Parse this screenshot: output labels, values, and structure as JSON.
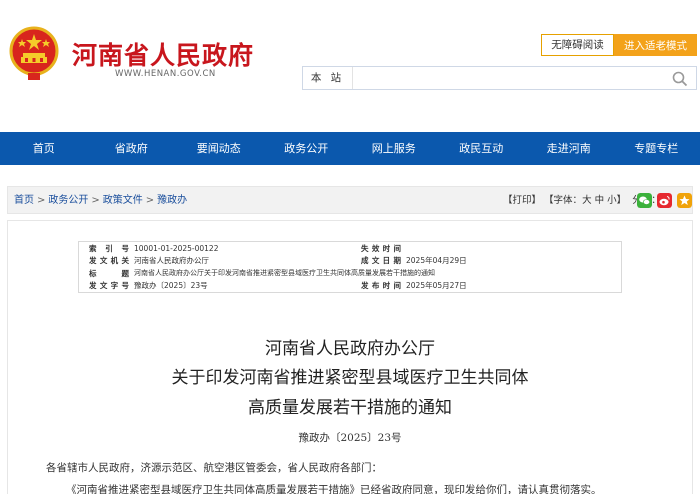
{
  "header": {
    "site_title": "河南省人民政府",
    "site_url": "WWW.HENAN.GOV.CN",
    "accessibility_label": "无障碍阅读",
    "elder_mode_label": "进入适老模式",
    "search_scope": "本 站",
    "search_placeholder": ""
  },
  "nav": {
    "items": [
      "首页",
      "省政府",
      "要闻动态",
      "政务公开",
      "网上服务",
      "政民互动",
      "走进河南",
      "专题专栏"
    ]
  },
  "breadcrumb": {
    "items": [
      "首页",
      "政务公开",
      "政策文件",
      "豫政办"
    ],
    "separator": ">"
  },
  "tools": {
    "print": "【打印】",
    "font_prefix": "【字体：",
    "font_large": "大",
    "font_medium": "中",
    "font_small": "小",
    "font_suffix": "】",
    "share_label": "分享："
  },
  "share": {
    "wechat_color": "#3bb13b",
    "weibo_color": "#e6282f",
    "favorite_color": "#f0a30a"
  },
  "meta": {
    "index_label": "索 引 号",
    "index_value": "10001-01-2025-00122",
    "validity_label": "失效时间",
    "validity_value": "",
    "issuer_label": "发文机关",
    "issuer_value": "河南省人民政府办公厅",
    "date_label": "成文日期",
    "date_value": "2025年04月29日",
    "title_label": "标　　题",
    "title_value": "河南省人民政府办公厅关于印发河南省推进紧密型县域医疗卫生共同体高质量发展若干措施的通知",
    "docno_label": "发文字号",
    "docno_value": "豫政办〔2025〕23号",
    "publish_label": "发布时间",
    "publish_value": "2025年05月27日"
  },
  "document": {
    "title_line1": "河南省人民政府办公厅",
    "title_line2": "关于印发河南省推进紧密型县域医疗卫生共同体",
    "title_line3": "高质量发展若干措施的通知",
    "doc_number": "豫政办〔2025〕23号",
    "salutation": "各省辖市人民政府，济源示范区、航空港区管委会，省人民政府各部门：",
    "body_line1": "《河南省推进紧密型县域医疗卫生共同体高质量发展若干措施》已经省政府同意，现印发给你们，请认真贯彻落实。"
  },
  "colors": {
    "brand_red": "#c8161d",
    "nav_blue": "#0b58ad",
    "accent_orange": "#f3a21a",
    "link_blue": "#1a4e9c"
  }
}
